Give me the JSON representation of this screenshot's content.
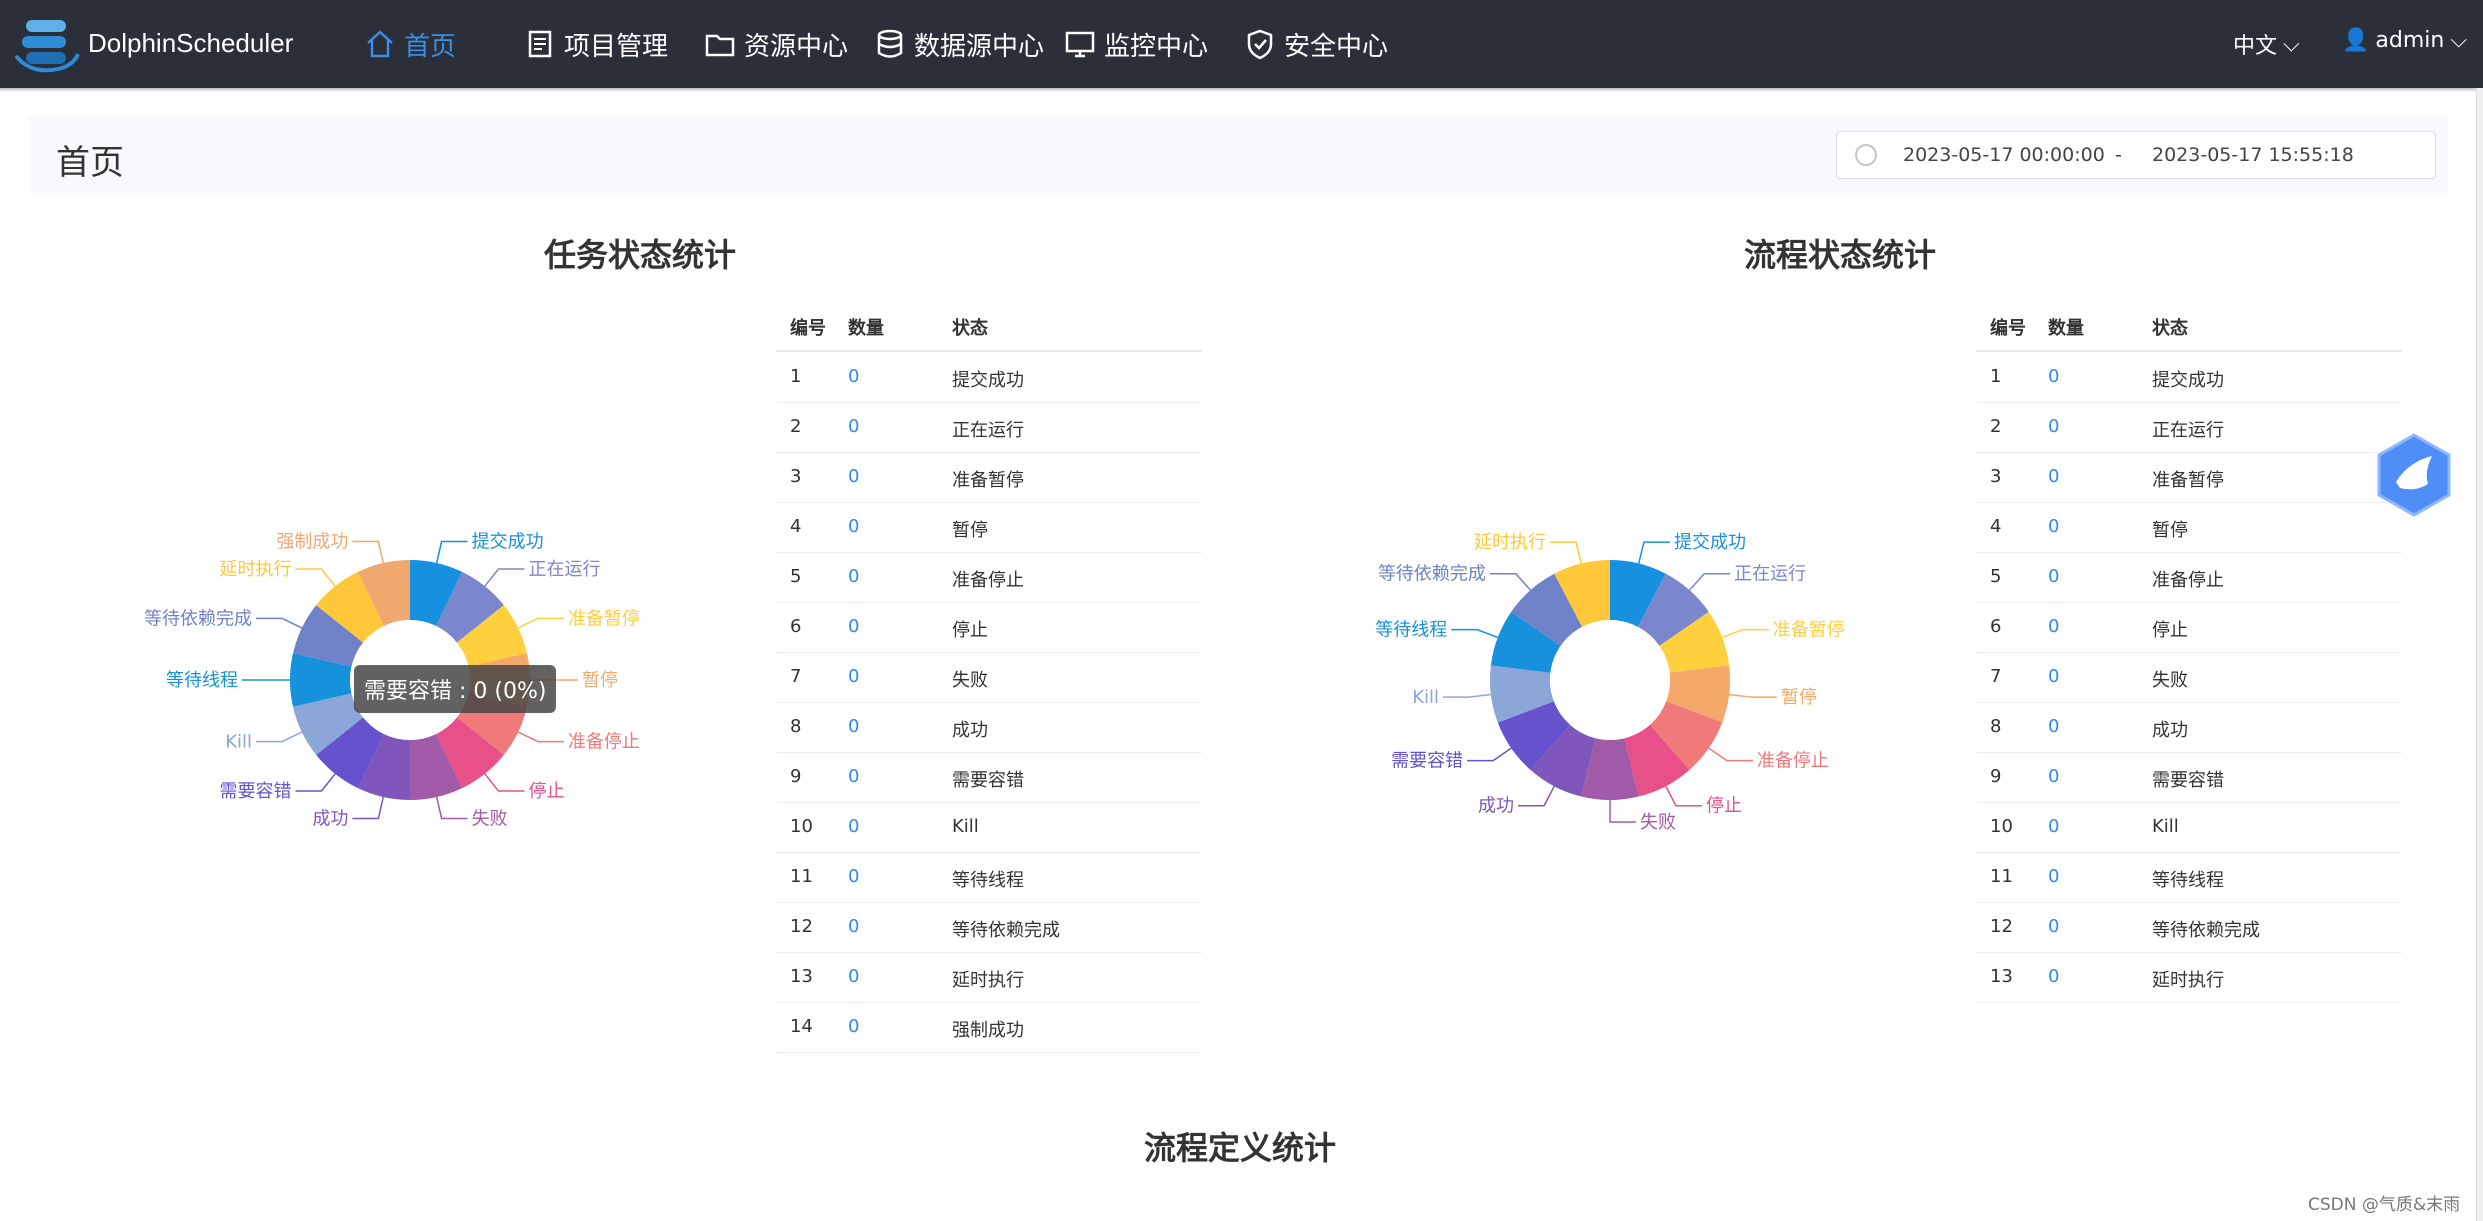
{
  "app": {
    "brand": "DolphinScheduler"
  },
  "nav": [
    {
      "label": "首页",
      "icon": "home-icon",
      "active": true
    },
    {
      "label": "项目管理",
      "icon": "project-icon"
    },
    {
      "label": "资源中心",
      "icon": "folder-icon"
    },
    {
      "label": "数据源中心",
      "icon": "database-icon"
    },
    {
      "label": "监控中心",
      "icon": "monitor-icon"
    },
    {
      "label": "安全中心",
      "icon": "shield-icon"
    }
  ],
  "header_right": {
    "language": "中文",
    "user": "admin"
  },
  "page": {
    "title": "首页"
  },
  "daterange": {
    "start": "2023-05-17 00:00:00",
    "separator": "-",
    "end": "2023-05-17 15:55:18"
  },
  "task_stats": {
    "title": "任务状态统计",
    "tooltip": "需要容错 : 0 (0%)",
    "table_headers": [
      "编号",
      "数量",
      "状态"
    ],
    "rows": [
      {
        "id": "1",
        "count": "0",
        "state": "提交成功"
      },
      {
        "id": "2",
        "count": "0",
        "state": "正在运行"
      },
      {
        "id": "3",
        "count": "0",
        "state": "准备暂停"
      },
      {
        "id": "4",
        "count": "0",
        "state": "暂停"
      },
      {
        "id": "5",
        "count": "0",
        "state": "准备停止"
      },
      {
        "id": "6",
        "count": "0",
        "state": "停止"
      },
      {
        "id": "7",
        "count": "0",
        "state": "失败"
      },
      {
        "id": "8",
        "count": "0",
        "state": "成功"
      },
      {
        "id": "9",
        "count": "0",
        "state": "需要容错"
      },
      {
        "id": "10",
        "count": "0",
        "state": "Kill"
      },
      {
        "id": "11",
        "count": "0",
        "state": "等待线程"
      },
      {
        "id": "12",
        "count": "0",
        "state": "等待依赖完成"
      },
      {
        "id": "13",
        "count": "0",
        "state": "延时执行"
      },
      {
        "id": "14",
        "count": "0",
        "state": "强制成功"
      }
    ]
  },
  "process_stats": {
    "title": "流程状态统计",
    "table_headers": [
      "编号",
      "数量",
      "状态"
    ],
    "rows": [
      {
        "id": "1",
        "count": "0",
        "state": "提交成功"
      },
      {
        "id": "2",
        "count": "0",
        "state": "正在运行"
      },
      {
        "id": "3",
        "count": "0",
        "state": "准备暂停"
      },
      {
        "id": "4",
        "count": "0",
        "state": "暂停"
      },
      {
        "id": "5",
        "count": "0",
        "state": "准备停止"
      },
      {
        "id": "6",
        "count": "0",
        "state": "停止"
      },
      {
        "id": "7",
        "count": "0",
        "state": "失败"
      },
      {
        "id": "8",
        "count": "0",
        "state": "成功"
      },
      {
        "id": "9",
        "count": "0",
        "state": "需要容错"
      },
      {
        "id": "10",
        "count": "0",
        "state": "Kill"
      },
      {
        "id": "11",
        "count": "0",
        "state": "等待线程"
      },
      {
        "id": "12",
        "count": "0",
        "state": "等待依赖完成"
      },
      {
        "id": "13",
        "count": "0",
        "state": "延时执行"
      }
    ]
  },
  "definition_stats": {
    "title": "流程定义统计"
  },
  "watermark": "CSDN @气质&末雨",
  "chart_data": [
    {
      "type": "pie",
      "title": "任务状态统计",
      "categories": [
        "提交成功",
        "正在运行",
        "准备暂停",
        "暂停",
        "准备停止",
        "停止",
        "失败",
        "成功",
        "需要容错",
        "Kill",
        "等待线程",
        "等待依赖完成",
        "延时执行",
        "强制成功"
      ],
      "values": [
        0,
        0,
        0,
        0,
        0,
        0,
        0,
        0,
        0,
        0,
        0,
        0,
        0,
        0
      ],
      "colors": [
        "#1890e0",
        "#7a87cc",
        "#ffcf3d",
        "#f4a86a",
        "#f07a7a",
        "#e8508a",
        "#a05aa8",
        "#7f56bb",
        "#6552cc",
        "#8ca6d8",
        "#1592db",
        "#6f82c8",
        "#ffc83a",
        "#f0a86e"
      ]
    },
    {
      "type": "pie",
      "title": "流程状态统计",
      "categories": [
        "提交成功",
        "正在运行",
        "准备暂停",
        "暂停",
        "准备停止",
        "停止",
        "失败",
        "成功",
        "需要容错",
        "Kill",
        "等待线程",
        "等待依赖完成",
        "延时执行"
      ],
      "values": [
        0,
        0,
        0,
        0,
        0,
        0,
        0,
        0,
        0,
        0,
        0,
        0,
        0
      ],
      "colors": [
        "#1890e0",
        "#7a87cc",
        "#ffcf3d",
        "#f4a86a",
        "#f07a7a",
        "#e8508a",
        "#a05aa8",
        "#7f56bb",
        "#6552cc",
        "#8ca6d8",
        "#1592db",
        "#6f82c8",
        "#ffc83a"
      ]
    }
  ]
}
